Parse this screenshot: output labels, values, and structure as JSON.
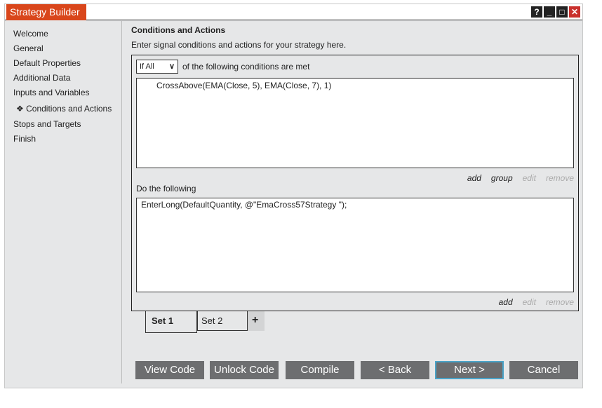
{
  "window": {
    "title": "Strategy Builder",
    "controls": [
      "?",
      "_",
      "□",
      "✕"
    ]
  },
  "sidebar": {
    "items": [
      {
        "label": "Welcome"
      },
      {
        "label": "General"
      },
      {
        "label": "Default Properties"
      },
      {
        "label": "Additional Data"
      },
      {
        "label": "Inputs and Variables"
      },
      {
        "label": "Conditions and Actions",
        "active": true,
        "marker": "❖"
      },
      {
        "label": "Stops and Targets"
      },
      {
        "label": "Finish"
      }
    ]
  },
  "main": {
    "heading": "Conditions and Actions",
    "subtitle": "Enter signal conditions and actions for your strategy here.",
    "condition_select": "If All",
    "condition_text": "of the following conditions are met",
    "conditions": [
      "CrossAbove(EMA(Close, 5), EMA(Close, 7), 1)"
    ],
    "condition_links": {
      "add": "add",
      "group": "group",
      "edit": "edit",
      "remove": "remove"
    },
    "actions_label": "Do the following",
    "actions": [
      "EnterLong(DefaultQuantity, @\"EmaCross57Strategy \");"
    ],
    "action_links": {
      "add": "add",
      "edit": "edit",
      "remove": "remove"
    },
    "sets": [
      {
        "label": "Set 1",
        "active": true
      },
      {
        "label": "Set 2"
      }
    ],
    "add_set": "+"
  },
  "footer": {
    "view_code": "View Code",
    "unlock_code": "Unlock Code",
    "compile": "Compile",
    "back": "< Back",
    "next": "Next >",
    "cancel": "Cancel"
  }
}
